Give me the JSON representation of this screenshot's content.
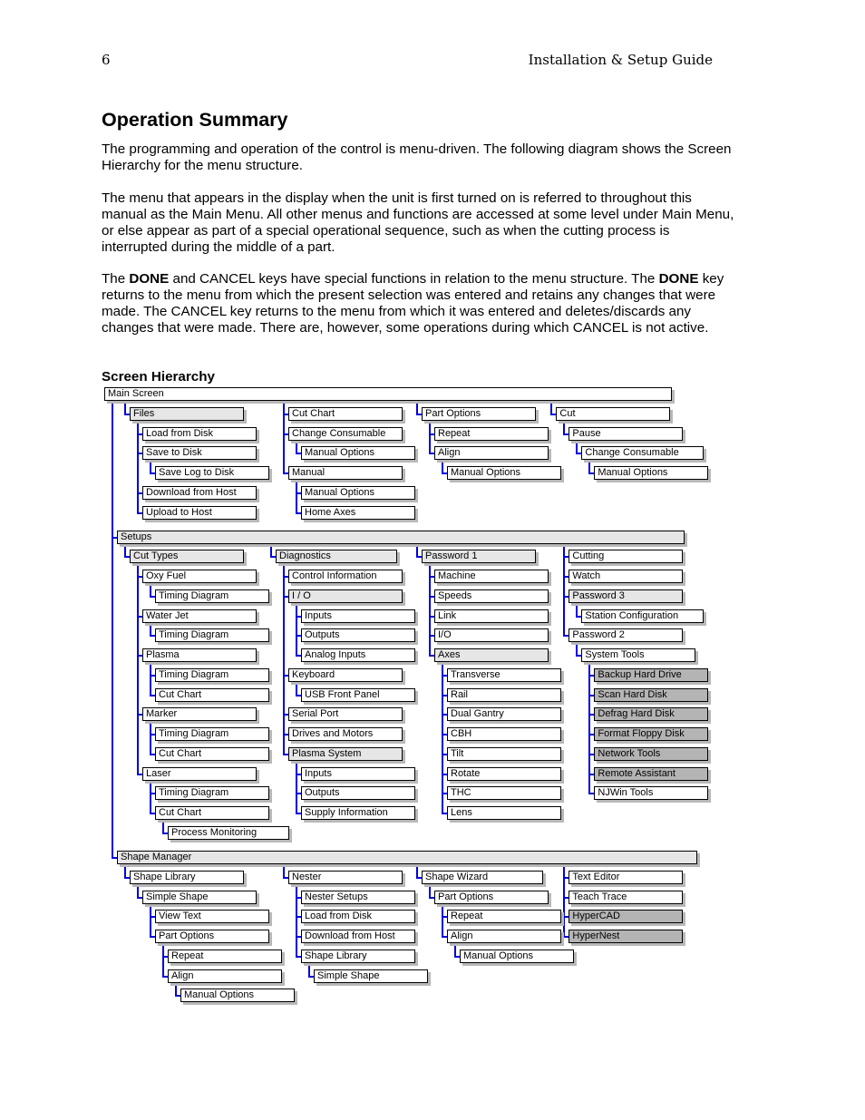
{
  "header": {
    "page_number": "6",
    "running_title": "Installation & Setup Guide"
  },
  "title": "Operation Summary",
  "paragraphs": [
    "The programming and operation of the control is menu-driven. The following diagram shows the Screen Hierarchy for the menu structure.",
    "The menu that appears in the display when the unit is first turned on is referred to throughout this manual as the Main Menu. All other menus and functions are accessed at some level under Main Menu, or else appear as part of a special operational sequence, such as when the cutting process is interrupted during the middle of a part.",
    {
      "parts": [
        {
          "t": "The "
        },
        {
          "t": "DONE",
          "b": true
        },
        {
          "t": " and CANCEL keys have special functions in relation to the menu structure. The "
        },
        {
          "t": "DONE",
          "b": true
        },
        {
          "t": " key returns to the menu from which the present selection was entered and retains any changes that were made. The CANCEL key returns to the menu from which it was entered and deletes/discards any changes that were made. There are, however, some operations during which CANCEL is not active."
        }
      ]
    }
  ],
  "section_heading": "Screen Hierarchy",
  "hierarchy": {
    "label": "Main Screen",
    "children": [
      {
        "label": "Files",
        "shade": "light",
        "children": [
          {
            "label": "Load from Disk"
          },
          {
            "label": "Save to Disk",
            "children": [
              {
                "label": "Save Log to Disk"
              }
            ]
          },
          {
            "label": "Download from Host"
          },
          {
            "label": "Upload to Host"
          }
        ]
      },
      {
        "label": "Cut Chart"
      },
      {
        "label": "Change Consumable",
        "children": [
          {
            "label": "Manual Options"
          }
        ]
      },
      {
        "label": "Manual",
        "children": [
          {
            "label": "Manual Options"
          },
          {
            "label": "Home Axes"
          }
        ]
      },
      {
        "label": "Part Options",
        "children": [
          {
            "label": "Repeat"
          },
          {
            "label": "Align",
            "children": [
              {
                "label": "Manual Options"
              }
            ]
          }
        ]
      },
      {
        "label": "Cut",
        "children": [
          {
            "label": "Pause",
            "children": [
              {
                "label": "Change Consumable",
                "children": [
                  {
                    "label": "Manual Options"
                  }
                ]
              }
            ]
          }
        ]
      },
      {
        "label": "Setups",
        "shade": "light",
        "children": [
          {
            "label": "Cut Types",
            "shade": "light",
            "children": [
              {
                "label": "Oxy Fuel",
                "children": [
                  {
                    "label": "Timing Diagram"
                  }
                ]
              },
              {
                "label": "Water Jet",
                "children": [
                  {
                    "label": "Timing Diagram"
                  }
                ]
              },
              {
                "label": "Plasma",
                "children": [
                  {
                    "label": "Timing Diagram"
                  },
                  {
                    "label": "Cut Chart"
                  }
                ]
              },
              {
                "label": "Marker",
                "children": [
                  {
                    "label": "Timing Diagram"
                  },
                  {
                    "label": "Cut Chart"
                  }
                ]
              },
              {
                "label": "Laser",
                "children": [
                  {
                    "label": "Timing Diagram"
                  },
                  {
                    "label": "Cut Chart",
                    "children": [
                      {
                        "label": "Process Monitoring"
                      }
                    ]
                  }
                ]
              }
            ]
          },
          {
            "label": "Diagnostics",
            "shade": "light",
            "children": [
              {
                "label": "Control Information"
              },
              {
                "label": "I / O",
                "shade": "light",
                "children": [
                  {
                    "label": "Inputs"
                  },
                  {
                    "label": "Outputs"
                  },
                  {
                    "label": "Analog Inputs"
                  }
                ]
              },
              {
                "label": "Keyboard",
                "children": [
                  {
                    "label": "USB Front Panel"
                  }
                ]
              },
              {
                "label": "Serial Port"
              },
              {
                "label": "Drives and Motors"
              },
              {
                "label": "Plasma System",
                "shade": "light",
                "children": [
                  {
                    "label": "Inputs"
                  },
                  {
                    "label": "Outputs"
                  },
                  {
                    "label": "Supply Information"
                  }
                ]
              }
            ]
          },
          {
            "label": "Password 1",
            "shade": "light",
            "children": [
              {
                "label": "Machine"
              },
              {
                "label": "Speeds"
              },
              {
                "label": "Link"
              },
              {
                "label": "I/O"
              },
              {
                "label": "Axes",
                "shade": "light",
                "children": [
                  {
                    "label": "Transverse"
                  },
                  {
                    "label": "Rail"
                  },
                  {
                    "label": "Dual Gantry"
                  },
                  {
                    "label": "CBH"
                  },
                  {
                    "label": "Tilt"
                  },
                  {
                    "label": "Rotate"
                  },
                  {
                    "label": "THC"
                  },
                  {
                    "label": "Lens"
                  }
                ]
              }
            ]
          },
          {
            "label": "Cutting"
          },
          {
            "label": "Watch"
          },
          {
            "label": "Password 3",
            "shade": "light",
            "children": [
              {
                "label": "Station Configuration"
              }
            ]
          },
          {
            "label": "Password 2",
            "children": [
              {
                "label": "System Tools",
                "children": [
                  {
                    "label": "Backup Hard Drive",
                    "shade": "dark"
                  },
                  {
                    "label": "Scan Hard Disk",
                    "shade": "dark"
                  },
                  {
                    "label": "Defrag Hard Disk",
                    "shade": "dark"
                  },
                  {
                    "label": "Format Floppy Disk",
                    "shade": "dark"
                  },
                  {
                    "label": "Network Tools",
                    "shade": "dark"
                  },
                  {
                    "label": "Remote Assistant",
                    "shade": "dark"
                  },
                  {
                    "label": "NJWin Tools"
                  }
                ]
              }
            ]
          }
        ]
      },
      {
        "label": "Shape Manager",
        "shade": "light",
        "children": [
          {
            "label": "Shape Library",
            "children": [
              {
                "label": "Simple Shape",
                "children": [
                  {
                    "label": "View Text"
                  },
                  {
                    "label": "Part Options",
                    "children": [
                      {
                        "label": "Repeat"
                      },
                      {
                        "label": "Align",
                        "children": [
                          {
                            "label": "Manual Options"
                          }
                        ]
                      }
                    ]
                  }
                ]
              }
            ]
          },
          {
            "label": "Nester",
            "children": [
              {
                "label": "Nester Setups"
              },
              {
                "label": "Load from Disk"
              },
              {
                "label": "Download from Host"
              },
              {
                "label": "Shape Library",
                "children": [
                  {
                    "label": "Simple Shape"
                  }
                ]
              }
            ]
          },
          {
            "label": "Shape Wizard",
            "children": [
              {
                "label": "Part Options",
                "children": [
                  {
                    "label": "Repeat"
                  },
                  {
                    "label": "Align",
                    "children": [
                      {
                        "label": "Manual Options"
                      }
                    ]
                  }
                ]
              }
            ]
          },
          {
            "label": "Text Editor"
          },
          {
            "label": "Teach Trace"
          },
          {
            "label": "HyperCAD",
            "shade": "dark"
          },
          {
            "label": "HyperNest",
            "shade": "dark"
          }
        ]
      }
    ]
  }
}
